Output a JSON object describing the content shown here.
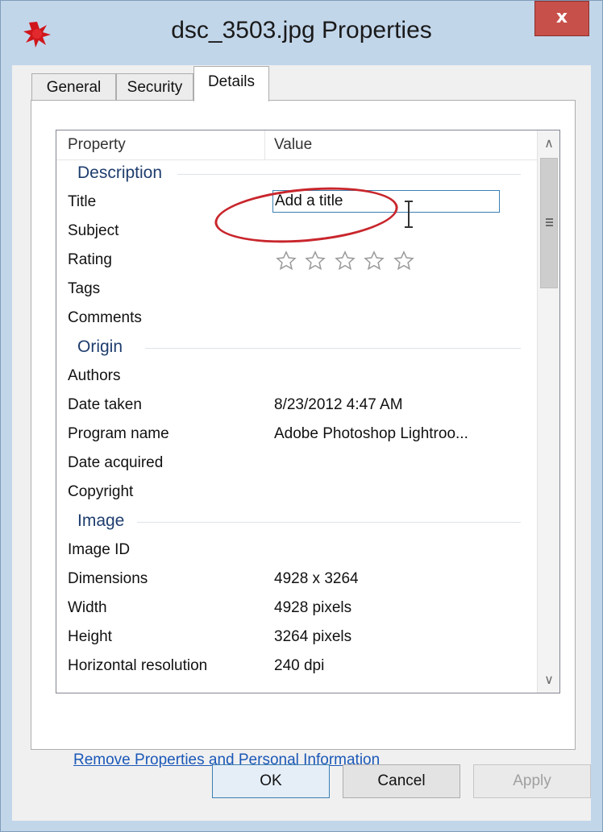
{
  "window": {
    "title": "dsc_3503.jpg Properties",
    "close_label": "x"
  },
  "tabs": [
    {
      "label": "General",
      "active": false
    },
    {
      "label": "Security",
      "active": false
    },
    {
      "label": "Details",
      "active": true
    }
  ],
  "columns": {
    "property": "Property",
    "value": "Value"
  },
  "groups": {
    "description": {
      "label": "Description",
      "rows": [
        {
          "property": "Title",
          "value": "Add a title"
        },
        {
          "property": "Subject",
          "value": ""
        },
        {
          "property": "Rating",
          "value": "",
          "stars": 0,
          "max_stars": 5
        },
        {
          "property": "Tags",
          "value": ""
        },
        {
          "property": "Comments",
          "value": ""
        }
      ]
    },
    "origin": {
      "label": "Origin",
      "rows": [
        {
          "property": "Authors",
          "value": ""
        },
        {
          "property": "Date taken",
          "value": "8/23/2012 4:47 AM"
        },
        {
          "property": "Program name",
          "value": "Adobe Photoshop Lightroo..."
        },
        {
          "property": "Date acquired",
          "value": ""
        },
        {
          "property": "Copyright",
          "value": ""
        }
      ]
    },
    "image": {
      "label": "Image",
      "rows": [
        {
          "property": "Image ID",
          "value": ""
        },
        {
          "property": "Dimensions",
          "value": "4928 x 3264"
        },
        {
          "property": "Width",
          "value": "4928 pixels"
        },
        {
          "property": "Height",
          "value": "3264 pixels"
        },
        {
          "property": "Horizontal resolution",
          "value": "240 dpi"
        }
      ]
    }
  },
  "links": {
    "remove_properties": "Remove Properties and Personal Information"
  },
  "buttons": {
    "ok": "OK",
    "cancel": "Cancel",
    "apply": "Apply"
  },
  "icons": {
    "app": "red-splat-icon",
    "close": "close-icon",
    "scroll_up": "chevron-up-icon",
    "scroll_down": "chevron-down-icon",
    "star": "star-outline-icon",
    "cursor": "text-cursor-icon"
  },
  "colors": {
    "annotation": "#c8262c",
    "link": "#1b58b8",
    "group_header": "#1e3d6e",
    "close_button": "#c7504a"
  }
}
